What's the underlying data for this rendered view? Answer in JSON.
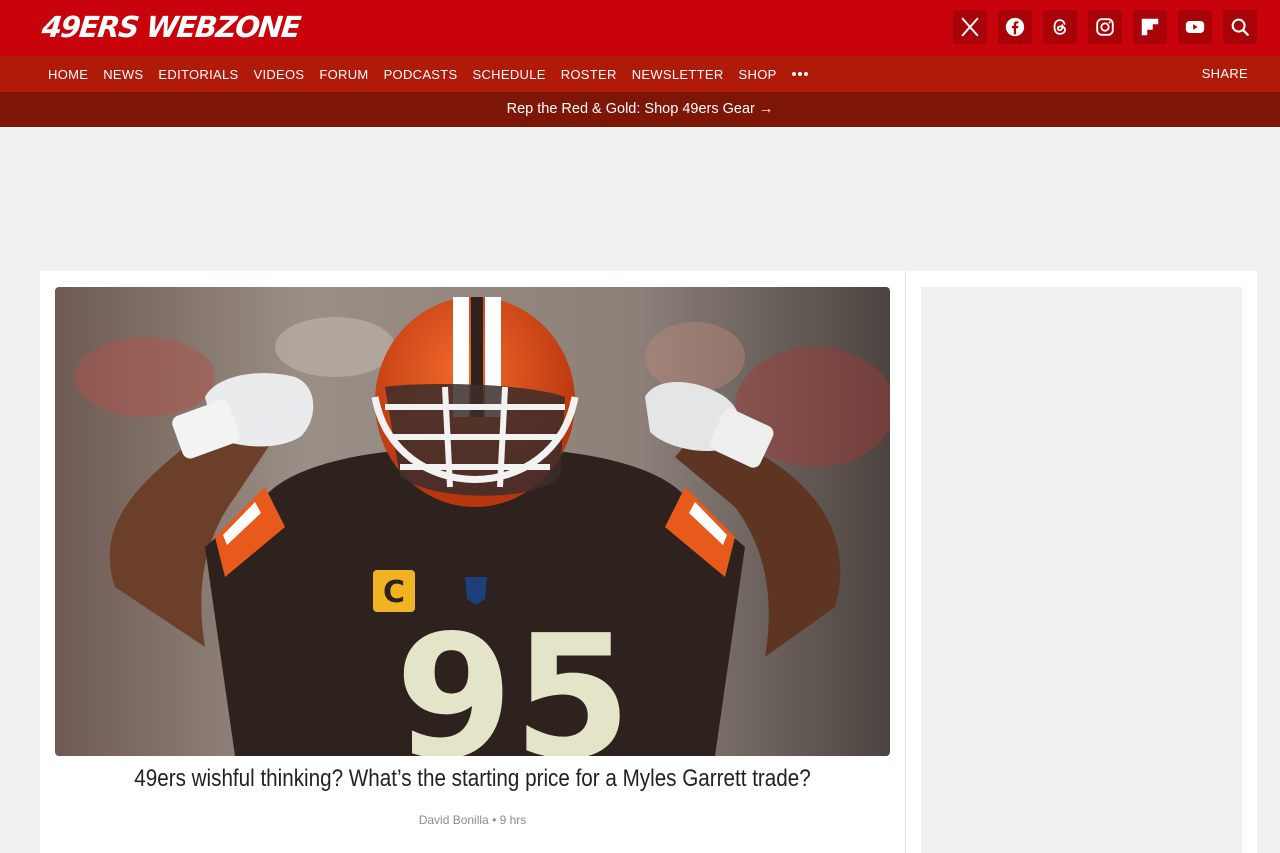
{
  "brand": {
    "logo_text": "49ERS WEBZONE",
    "primary_color": "#c8030b",
    "nav_color": "#b01a09",
    "promo_color": "#7e1607"
  },
  "social_icons": [
    "x-icon",
    "facebook-icon",
    "threads-icon",
    "instagram-icon",
    "flipboard-icon",
    "youtube-icon",
    "search-icon"
  ],
  "nav": {
    "items": [
      {
        "label": "HOME"
      },
      {
        "label": "NEWS"
      },
      {
        "label": "EDITORIALS"
      },
      {
        "label": "VIDEOS"
      },
      {
        "label": "FORUM"
      },
      {
        "label": "PODCASTS"
      },
      {
        "label": "SCHEDULE"
      },
      {
        "label": "ROSTER"
      },
      {
        "label": "NEWSLETTER"
      },
      {
        "label": "SHOP"
      }
    ],
    "more_icon": "ellipsis-icon",
    "share_label": "SHARE"
  },
  "promo": {
    "text": "Rep the Red & Gold: Shop 49ers Gear",
    "arrow": "→"
  },
  "article": {
    "headline": "49ers wishful thinking? What’s the starting price for a Myles Garrett trade?",
    "author": "David Bonilla",
    "separator": "•",
    "time": "9 hrs"
  }
}
